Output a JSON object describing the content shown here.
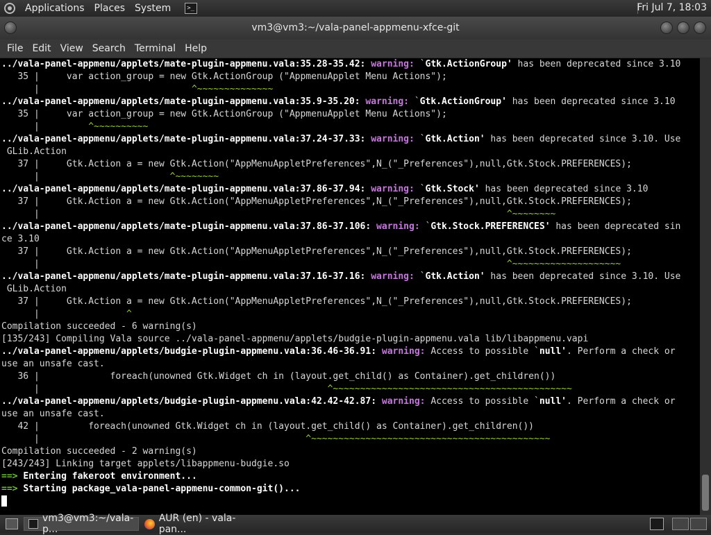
{
  "top_panel": {
    "menus": [
      "Applications",
      "Places",
      "System"
    ],
    "clock": "Fri Jul 7, 18:03"
  },
  "window": {
    "title": "vm3@vm3:~/vala-panel-appmenu-xfce-git",
    "menus": [
      "File",
      "Edit",
      "View",
      "Search",
      "Terminal",
      "Help"
    ]
  },
  "terminal": {
    "lines": [
      [
        [
          "../vala-panel-appmenu/applets/mate-plugin-appmenu.vala:35.28-35.42: ",
          "b"
        ],
        [
          "warning: ",
          "w"
        ],
        [
          "`",
          "n"
        ],
        [
          "Gtk.ActionGroup'",
          "b"
        ],
        [
          " has been deprecated since 3.10",
          "n"
        ]
      ],
      [
        [
          "   35 |     var action_group = new Gtk.ActionGroup (\"AppmenuApplet Menu Actions\");",
          "n"
        ]
      ],
      [
        [
          "      |                            ",
          "n"
        ],
        [
          "^~~~~~~~~~~~~~~",
          "g"
        ]
      ],
      [
        [
          "../vala-panel-appmenu/applets/mate-plugin-appmenu.vala:35.9-35.20: ",
          "b"
        ],
        [
          "warning: ",
          "w"
        ],
        [
          "`",
          "n"
        ],
        [
          "Gtk.ActionGroup'",
          "b"
        ],
        [
          " has been deprecated since 3.10",
          "n"
        ]
      ],
      [
        [
          "   35 |     var action_group = new Gtk.ActionGroup (\"AppmenuApplet Menu Actions\");",
          "n"
        ]
      ],
      [
        [
          "      |         ",
          "n"
        ],
        [
          "^~~~~~~~~~~",
          "g"
        ]
      ],
      [
        [
          "../vala-panel-appmenu/applets/mate-plugin-appmenu.vala:37.24-37.33: ",
          "b"
        ],
        [
          "warning: ",
          "w"
        ],
        [
          "`",
          "n"
        ],
        [
          "Gtk.Action'",
          "b"
        ],
        [
          " has been deprecated since 3.10. Use",
          "n"
        ]
      ],
      [
        [
          " GLib.Action",
          "n"
        ]
      ],
      [
        [
          "   37 |     Gtk.Action a = new Gtk.Action(\"AppMenuAppletPreferences\",N_(\"_Preferences\"),null,Gtk.Stock.PREFERENCES);",
          "n"
        ]
      ],
      [
        [
          "      |                        ",
          "n"
        ],
        [
          "^~~~~~~~~",
          "g"
        ]
      ],
      [
        [
          "../vala-panel-appmenu/applets/mate-plugin-appmenu.vala:37.86-37.94: ",
          "b"
        ],
        [
          "warning: ",
          "w"
        ],
        [
          "`",
          "n"
        ],
        [
          "Gtk.Stock'",
          "b"
        ],
        [
          " has been deprecated since 3.10",
          "n"
        ]
      ],
      [
        [
          "   37 |     Gtk.Action a = new Gtk.Action(\"AppMenuAppletPreferences\",N_(\"_Preferences\"),null,Gtk.Stock.PREFERENCES);",
          "n"
        ]
      ],
      [
        [
          "      |                                                                                      ",
          "n"
        ],
        [
          "^~~~~~~~~",
          "g"
        ]
      ],
      [
        [
          "../vala-panel-appmenu/applets/mate-plugin-appmenu.vala:37.86-37.106: ",
          "b"
        ],
        [
          "warning: ",
          "w"
        ],
        [
          "`",
          "n"
        ],
        [
          "Gtk.Stock.PREFERENCES'",
          "b"
        ],
        [
          " has been deprecated sin",
          "n"
        ]
      ],
      [
        [
          "ce 3.10",
          "n"
        ]
      ],
      [
        [
          "   37 |     Gtk.Action a = new Gtk.Action(\"AppMenuAppletPreferences\",N_(\"_Preferences\"),null,Gtk.Stock.PREFERENCES);",
          "n"
        ]
      ],
      [
        [
          "      |                                                                                      ",
          "n"
        ],
        [
          "^~~~~~~~~~~~~~~~~~~~~",
          "g"
        ]
      ],
      [
        [
          "../vala-panel-appmenu/applets/mate-plugin-appmenu.vala:37.16-37.16: ",
          "b"
        ],
        [
          "warning: ",
          "w"
        ],
        [
          "`",
          "n"
        ],
        [
          "Gtk.Action'",
          "b"
        ],
        [
          " has been deprecated since 3.10. Use",
          "n"
        ]
      ],
      [
        [
          " GLib.Action",
          "n"
        ]
      ],
      [
        [
          "   37 |     Gtk.Action a = new Gtk.Action(\"AppMenuAppletPreferences\",N_(\"_Preferences\"),null,Gtk.Stock.PREFERENCES);",
          "n"
        ]
      ],
      [
        [
          "      |                ",
          "n"
        ],
        [
          "^",
          "g"
        ]
      ],
      [
        [
          "Compilation succeeded - 6 warning(s)",
          "n"
        ]
      ],
      [
        [
          "[135/243] Compiling Vala source ../vala-panel-appmenu/applets/budgie-plugin-appmenu.vala lib/libappmenu.vapi",
          "n"
        ]
      ],
      [
        [
          "../vala-panel-appmenu/applets/budgie-plugin-appmenu.vala:36.46-36.91: ",
          "b"
        ],
        [
          "warning: ",
          "w"
        ],
        [
          "Access to possible `",
          "n"
        ],
        [
          "null'",
          "b"
        ],
        [
          ". Perform a check or",
          "n"
        ]
      ],
      [
        [
          "use an unsafe cast.",
          "n"
        ]
      ],
      [
        [
          "   36 |             foreach(unowned Gtk.Widget ch in (layout.get_child() as Container).get_children())",
          "n"
        ]
      ],
      [
        [
          "      |                                                     ",
          "n"
        ],
        [
          "^~~~~~~~~~~~~~~~~~~~~~~~~~~~~~~~~~~~~~~~~~~~~",
          "g"
        ]
      ],
      [
        [
          "../vala-panel-appmenu/applets/budgie-plugin-appmenu.vala:42.42-42.87: ",
          "b"
        ],
        [
          "warning: ",
          "w"
        ],
        [
          "Access to possible `",
          "n"
        ],
        [
          "null'",
          "b"
        ],
        [
          ". Perform a check or",
          "n"
        ]
      ],
      [
        [
          "use an unsafe cast.",
          "n"
        ]
      ],
      [
        [
          "   42 |         foreach(unowned Gtk.Widget ch in (layout.get_child() as Container).get_children())",
          "n"
        ]
      ],
      [
        [
          "      |                                                 ",
          "n"
        ],
        [
          "^~~~~~~~~~~~~~~~~~~~~~~~~~~~~~~~~~~~~~~~~~~~~",
          "g"
        ]
      ],
      [
        [
          "Compilation succeeded - 2 warning(s)",
          "n"
        ]
      ],
      [
        [
          "[243/243] Linking target applets/libappmenu-budgie.so",
          "n"
        ]
      ],
      [
        [
          "==> ",
          "a"
        ],
        [
          "Entering fakeroot environment...",
          "b"
        ]
      ],
      [
        [
          "==> ",
          "a"
        ],
        [
          "Starting package_vala-panel-appmenu-common-git()...",
          "b"
        ]
      ]
    ]
  },
  "taskbar": {
    "tasks": [
      "vm3@vm3:~/vala-p...",
      "AUR (en) - vala-pan..."
    ]
  },
  "icons": {
    "distro": "os-logo-icon",
    "terminal": "terminal-icon",
    "browser": "firefox-icon",
    "show_desktop": "show-desktop-icon",
    "workspace": "workspace-switcher-icon"
  },
  "colors": {
    "warning": "#c678dd",
    "caret": "#9acd32",
    "arrow": "#6fbf3a"
  }
}
